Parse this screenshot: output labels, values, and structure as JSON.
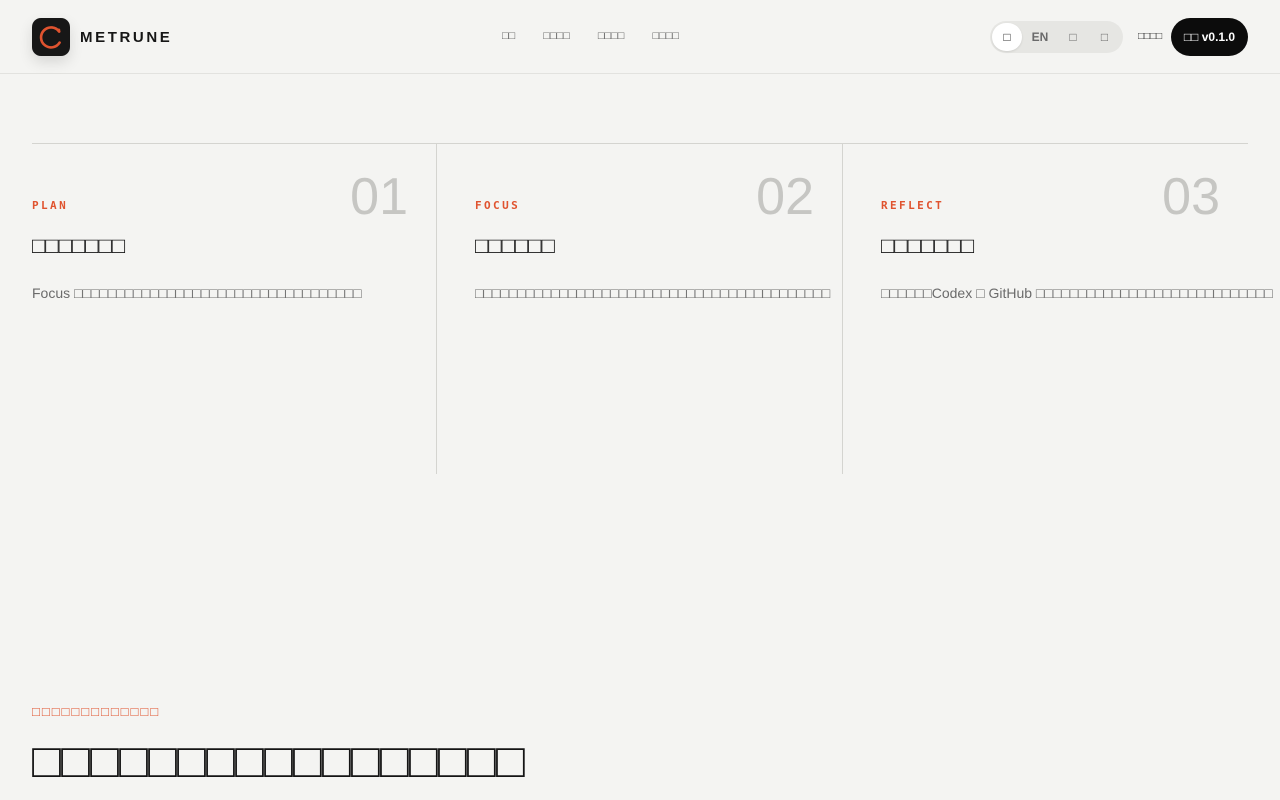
{
  "header": {
    "brand": "METRUNE",
    "nav": [
      "□□",
      "□□□□",
      "□□□□",
      "□□□□"
    ],
    "lang_options": [
      "□",
      "EN",
      "□",
      "□"
    ],
    "lang_selected_index": 0,
    "link": "□□□□",
    "download_label": "□□ v0.1.0"
  },
  "steps": [
    {
      "num": "01",
      "kicker": "PLAN",
      "title": "□□□□□□□",
      "desc": "Focus □□□□□□□□□□□□□□□□□□□□□□□□□□□□□□□□□□"
    },
    {
      "num": "02",
      "kicker": "FOCUS",
      "title": "□□□□□□",
      "desc": "□□□□□□□□□□□□□□□□□□□□□□□□□□□□□□□□□□□□□□□□□□"
    },
    {
      "num": "03",
      "kicker": "REFLECT",
      "title": "□□□□□□□",
      "desc": "□□□□□□Codex □ GitHub □□□□□□□□□□□□□□□□□□□□□□□□□□□□"
    }
  ],
  "section": {
    "kicker": "□□□□□□□□□□□□□",
    "title": "□□□□□□□□□□□□□□□□□"
  },
  "colors": {
    "background": "#f4f4f2",
    "accent": "#e0532f",
    "dark": "#0c0c0c",
    "muted_number": "#c6c6c3"
  },
  "icons": {
    "logo": "ring-logo-icon"
  }
}
